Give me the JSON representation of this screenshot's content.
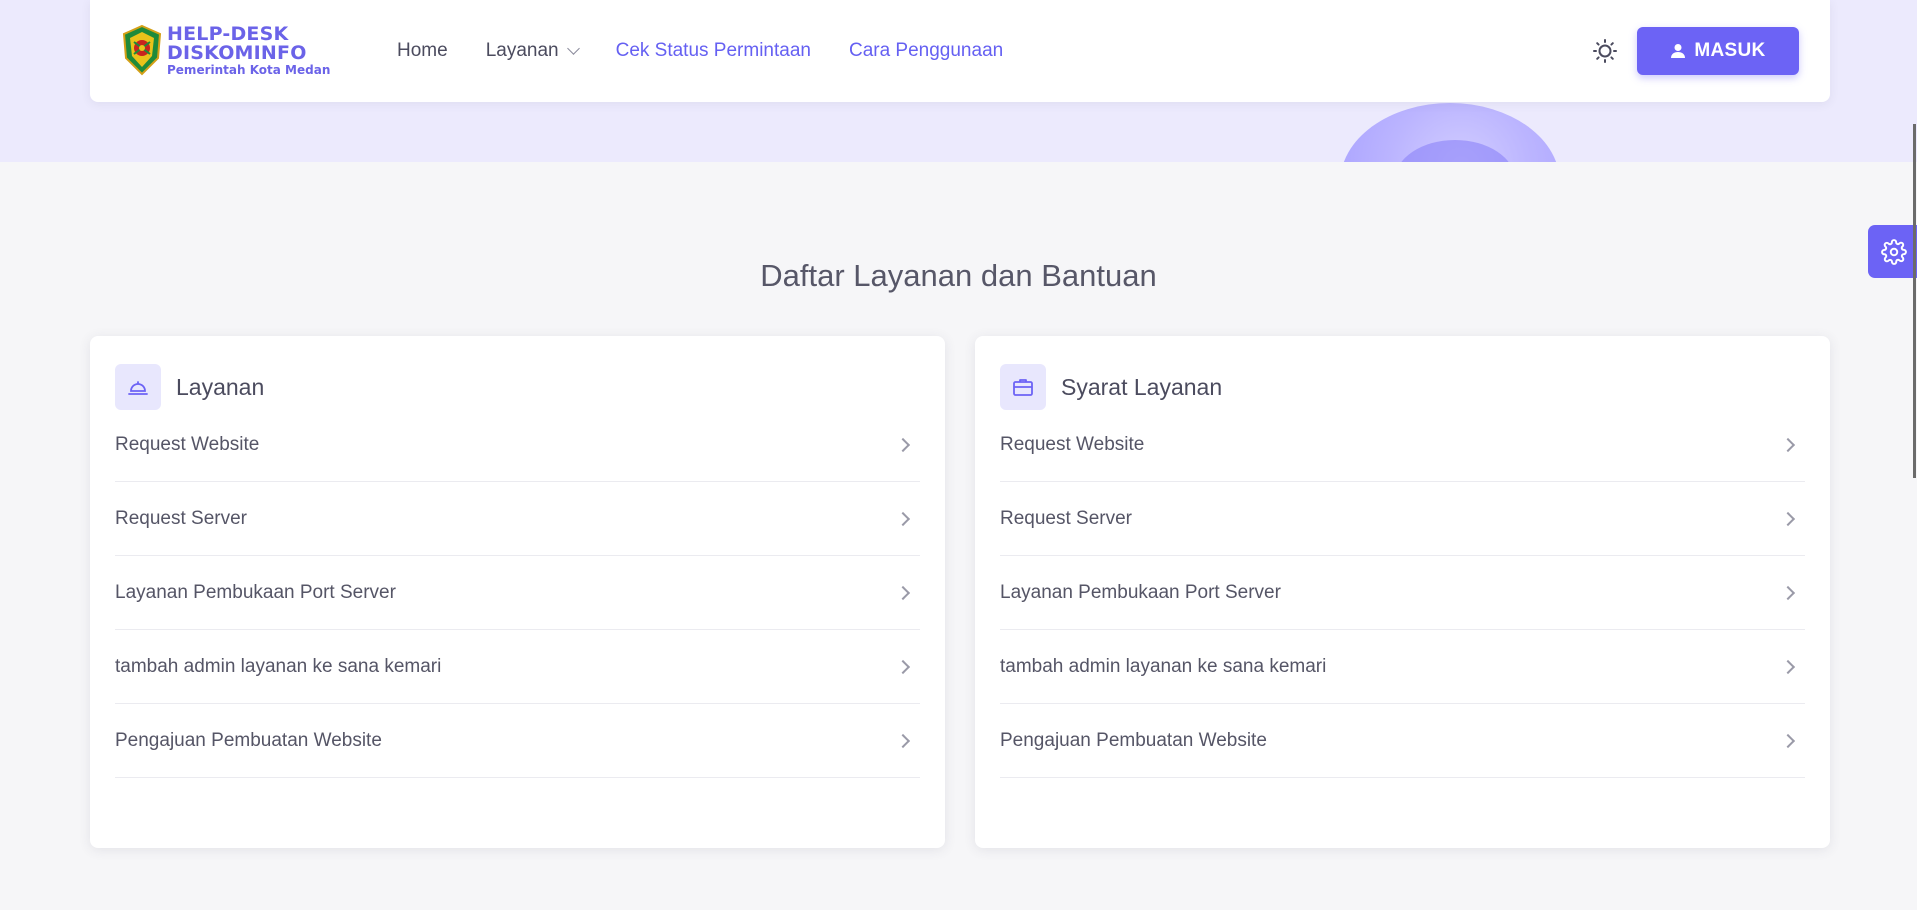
{
  "brand": {
    "line1": "HELP-DESK",
    "line2": "DISKOMINFO",
    "line3": "Pemerintah Kota Medan"
  },
  "nav": {
    "home": "Home",
    "services": "Layanan",
    "check_status": "Cek Status Permintaan",
    "how_to": "Cara Penggunaan"
  },
  "login_label": "MASUK",
  "section_title": "Daftar Layanan dan Bantuan",
  "cards": [
    {
      "title": "Layanan",
      "icon": "bell-icon",
      "items": [
        "Request Website",
        "Request Server",
        "Layanan Pembukaan Port Server",
        "tambah admin layanan ke sana kemari",
        "Pengajuan Pembuatan Website"
      ]
    },
    {
      "title": "Syarat Layanan",
      "icon": "briefcase-icon",
      "items": [
        "Request Website",
        "Request Server",
        "Layanan Pembukaan Port Server",
        "tambah admin layanan ke sana kemari",
        "Pengajuan Pembuatan Website"
      ]
    }
  ],
  "colors": {
    "accent": "#6c63f5",
    "hero_band": "#eceafd",
    "page_bg": "#f6f6f8"
  }
}
